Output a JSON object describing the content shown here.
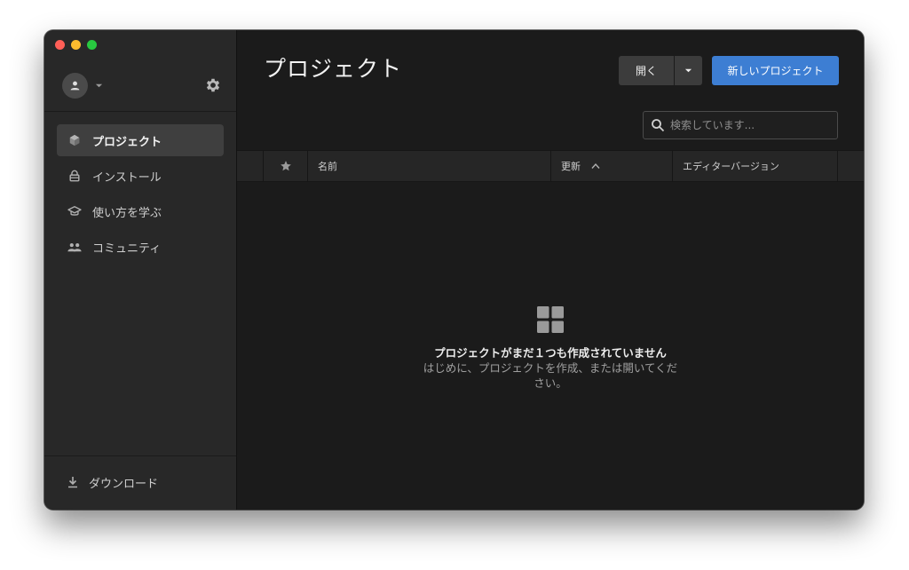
{
  "sidebar": {
    "nav": [
      {
        "label": "プロジェクト",
        "icon": "cube-icon",
        "active": true
      },
      {
        "label": "インストール",
        "icon": "lock-icon",
        "active": false
      },
      {
        "label": "使い方を学ぶ",
        "icon": "graduation-cap-icon",
        "active": false
      },
      {
        "label": "コミュニティ",
        "icon": "people-icon",
        "active": false
      }
    ],
    "download_label": "ダウンロード"
  },
  "main": {
    "title": "プロジェクト",
    "open_label": "開く",
    "new_project_label": "新しいプロジェクト",
    "search_placeholder": "検索しています...",
    "table": {
      "columns": {
        "name": "名前",
        "updated": "更新",
        "editor_version": "エディターバージョン"
      }
    },
    "empty_state": {
      "title": "プロジェクトがまだ１つも作成されていません",
      "subtitle_line1": "はじめに、プロジェクトを作成、または開いてくだ",
      "subtitle_line2": "さい。"
    }
  },
  "colors": {
    "accent": "#3d7ed3",
    "sidebar_bg": "#282828",
    "main_bg": "#1b1b1b",
    "active_nav_bg": "#3f3f3f"
  }
}
